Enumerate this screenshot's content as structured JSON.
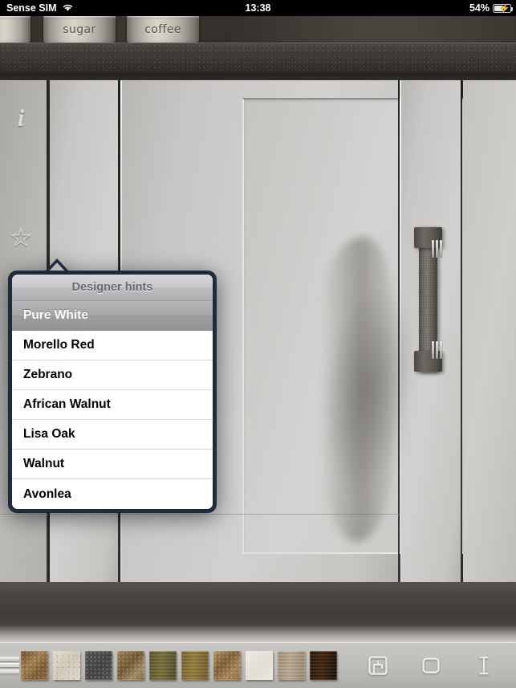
{
  "statusbar": {
    "carrier": "Sense SIM",
    "wifi_icon": "wifi-icon",
    "time": "13:38",
    "battery_percent": "54%",
    "battery_icon": "battery-charging-icon"
  },
  "scene": {
    "canisters": [
      {
        "label": ""
      },
      {
        "label": "sugar"
      },
      {
        "label": "coffee"
      }
    ],
    "edge_tools": [
      {
        "name": "info-icon",
        "glyph": "i"
      },
      {
        "name": "favourite-star-icon",
        "glyph": "☆"
      }
    ]
  },
  "popover": {
    "title": "Designer hints",
    "items": [
      {
        "label": "Pure White",
        "selected": true
      },
      {
        "label": "Morello Red",
        "selected": false
      },
      {
        "label": "Zebrano",
        "selected": false
      },
      {
        "label": "African Walnut",
        "selected": false
      },
      {
        "label": "Lisa Oak",
        "selected": false
      },
      {
        "label": "Walnut",
        "selected": false
      },
      {
        "label": "Avonlea",
        "selected": false
      }
    ],
    "border_color": "#1e2b3d",
    "selected_text_color": "#ffffff"
  },
  "toolbar": {
    "menu_icon": "hamburger-menu-icon",
    "swatches": [
      {
        "name": "swatch-brown-granite",
        "color": "#8a6a42"
      },
      {
        "name": "swatch-cream-stone",
        "color": "#ddd6c6"
      },
      {
        "name": "swatch-dark-grey-stone",
        "color": "#4c4b4c"
      },
      {
        "name": "swatch-tan-granite",
        "color": "#8b7352"
      },
      {
        "name": "swatch-olive-oak",
        "color": "#6b6333"
      },
      {
        "name": "swatch-golden-oak",
        "color": "#8a7236"
      },
      {
        "name": "swatch-speckled-granite",
        "color": "#9a7a4c"
      },
      {
        "name": "swatch-white-stone",
        "color": "#e8e4da"
      },
      {
        "name": "swatch-light-oak",
        "color": "#b3a089"
      },
      {
        "name": "swatch-espresso-wood",
        "color": "#33200f"
      }
    ],
    "tools": [
      {
        "name": "floor-plan-icon"
      },
      {
        "name": "rounded-square-icon"
      },
      {
        "name": "measure-height-icon"
      },
      {
        "name": "brightness-sun-icon"
      }
    ]
  }
}
